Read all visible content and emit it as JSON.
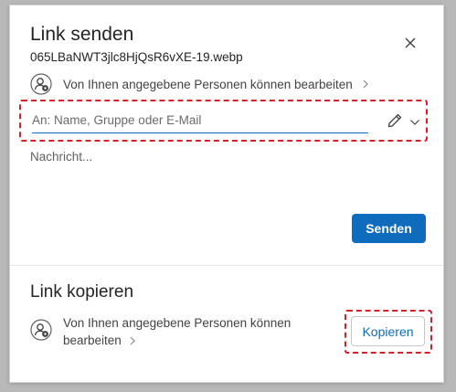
{
  "send_link": {
    "title": "Link senden",
    "filename": "065LBaNWT3jlc8HjQsR6vXE-19.webp",
    "permission": "Von Ihnen angegebene Personen können bearbeiten",
    "to_placeholder": "An: Name, Gruppe oder E-Mail",
    "to_value": "",
    "message_placeholder": "Nachricht...",
    "send_label": "Senden"
  },
  "copy_link": {
    "title": "Link kopieren",
    "permission": "Von Ihnen angegebene Personen können bearbeiten",
    "copy_label": "Kopieren"
  },
  "icons": {
    "close": "close-icon",
    "permission": "people-settings-icon",
    "pencil": "pencil-icon",
    "chevron_down": "chevron-down-icon",
    "chevron_right": "chevron-right-icon"
  },
  "colors": {
    "accent": "#0f6cbd",
    "highlight": "#d6202a"
  }
}
